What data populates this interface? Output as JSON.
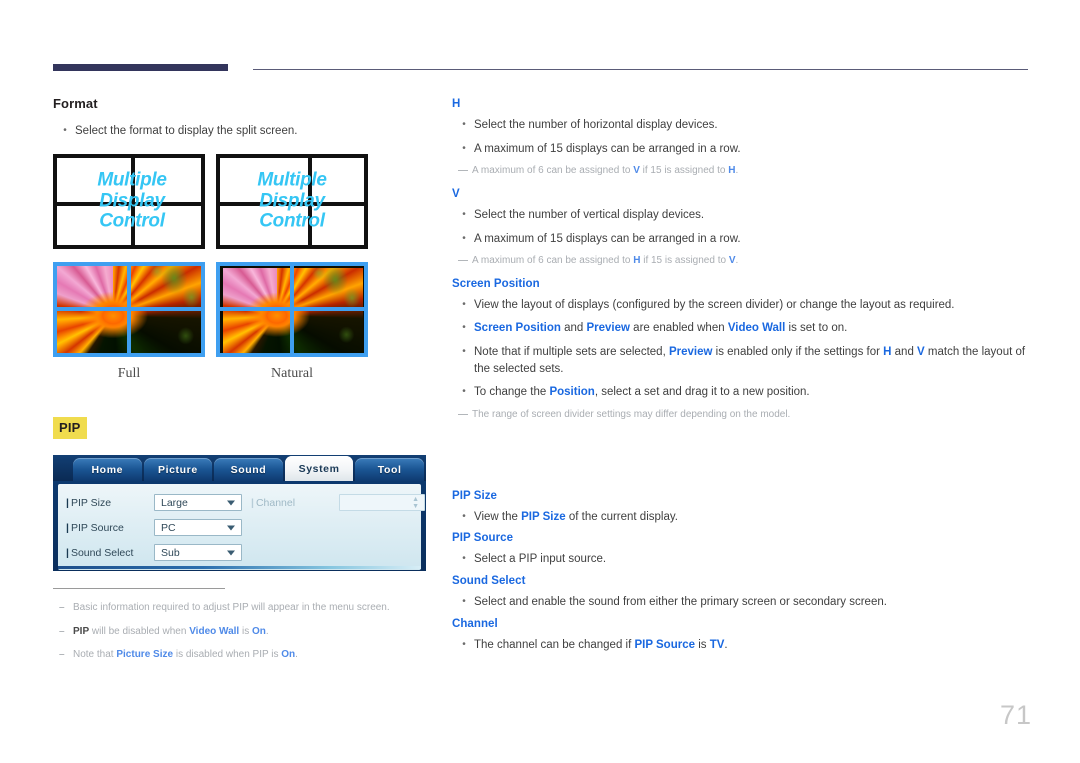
{
  "page": {
    "number": "71"
  },
  "left": {
    "format": {
      "heading": "Format",
      "bullet": "Select the format to display the split screen.",
      "wall_text_line1": "Multiple",
      "wall_text_line2": "Display",
      "wall_text_line3": "Control",
      "caption_full": "Full",
      "caption_natural": "Natural"
    },
    "pip": {
      "badge": "PIP",
      "osd": {
        "tabs": [
          {
            "label": "Home",
            "selected": false
          },
          {
            "label": "Picture",
            "selected": false
          },
          {
            "label": "Sound",
            "selected": false
          },
          {
            "label": "System",
            "selected": true
          },
          {
            "label": "Tool",
            "selected": false
          }
        ],
        "rows": [
          {
            "label": "PIP Size",
            "value": "Large"
          },
          {
            "label": "PIP Source",
            "value": "PC"
          },
          {
            "label": "Sound Select",
            "value": "Sub"
          }
        ],
        "channel": {
          "label": "Channel",
          "value": "",
          "up_glyph": "▲",
          "down_glyph": "▼"
        }
      },
      "footnotes": [
        {
          "text_before": "Basic information required to adjust PIP will appear in the menu screen.",
          "bold1": "",
          "text_mid": "",
          "bold2": "",
          "text_after": ""
        },
        {
          "text_before": "",
          "bold1": "PIP",
          "text_mid": " will be disabled when ",
          "bold2": "Video Wall",
          "text_after": " is ",
          "bold3": "On",
          "text_end": "."
        },
        {
          "text_before": "Note that ",
          "bold1": "Picture Size",
          "text_mid": " is disabled when PIP is ",
          "bold2": "On",
          "text_after": "."
        }
      ]
    }
  },
  "right": {
    "h": {
      "heading": "H",
      "bullets": [
        "Select the number of horizontal display devices.",
        "A maximum of 15 displays can be arranged in a row."
      ],
      "note_pre": "A maximum of 6 can be assigned to ",
      "note_b1": "V",
      "note_mid": " if 15 is assigned to ",
      "note_b2": "H",
      "note_end": "."
    },
    "v": {
      "heading": "V",
      "bullets": [
        "Select the number of vertical display devices.",
        "A maximum of 15 displays can be arranged in a row."
      ],
      "note_pre": "A maximum of 6 can be assigned to ",
      "note_b1": "H",
      "note_mid": " if 15 is assigned to ",
      "note_b2": "V",
      "note_end": "."
    },
    "screen_position": {
      "heading": "Screen Position",
      "b1": "View the layout of displays (configured by the screen divider) or change the layout as required.",
      "b2_p1": "Screen Position",
      "b2_p2": " and ",
      "b2_p3": "Preview",
      "b2_p4": " are enabled when ",
      "b2_p5": "Video Wall",
      "b2_p6": " is set to on.",
      "b3_p1": "Note that if multiple sets are selected, ",
      "b3_p2": "Preview",
      "b3_p3": " is enabled only if the settings for ",
      "b3_p4": "H",
      "b3_p5": " and ",
      "b3_p6": "V",
      "b3_p7": " match the layout of the selected sets.",
      "b4_p1": "To change the ",
      "b4_p2": "Position",
      "b4_p3": ", select a set and drag it to a new position.",
      "note": "The range of screen divider settings may differ depending on the model."
    },
    "pip_size": {
      "heading": "PIP Size",
      "b1_p1": "View the ",
      "b1_p2": "PIP Size",
      "b1_p3": " of the current display."
    },
    "pip_source": {
      "heading": "PIP Source",
      "b1": "Select a PIP input source."
    },
    "sound_select": {
      "heading": "Sound Select",
      "b1": "Select and enable the sound from either the primary screen or secondary screen."
    },
    "channel": {
      "heading": "Channel",
      "b1_p1": "The channel can be changed if ",
      "b1_p2": "PIP Source",
      "b1_p3": " is ",
      "b1_p4": "TV",
      "b1_p5": "."
    }
  }
}
